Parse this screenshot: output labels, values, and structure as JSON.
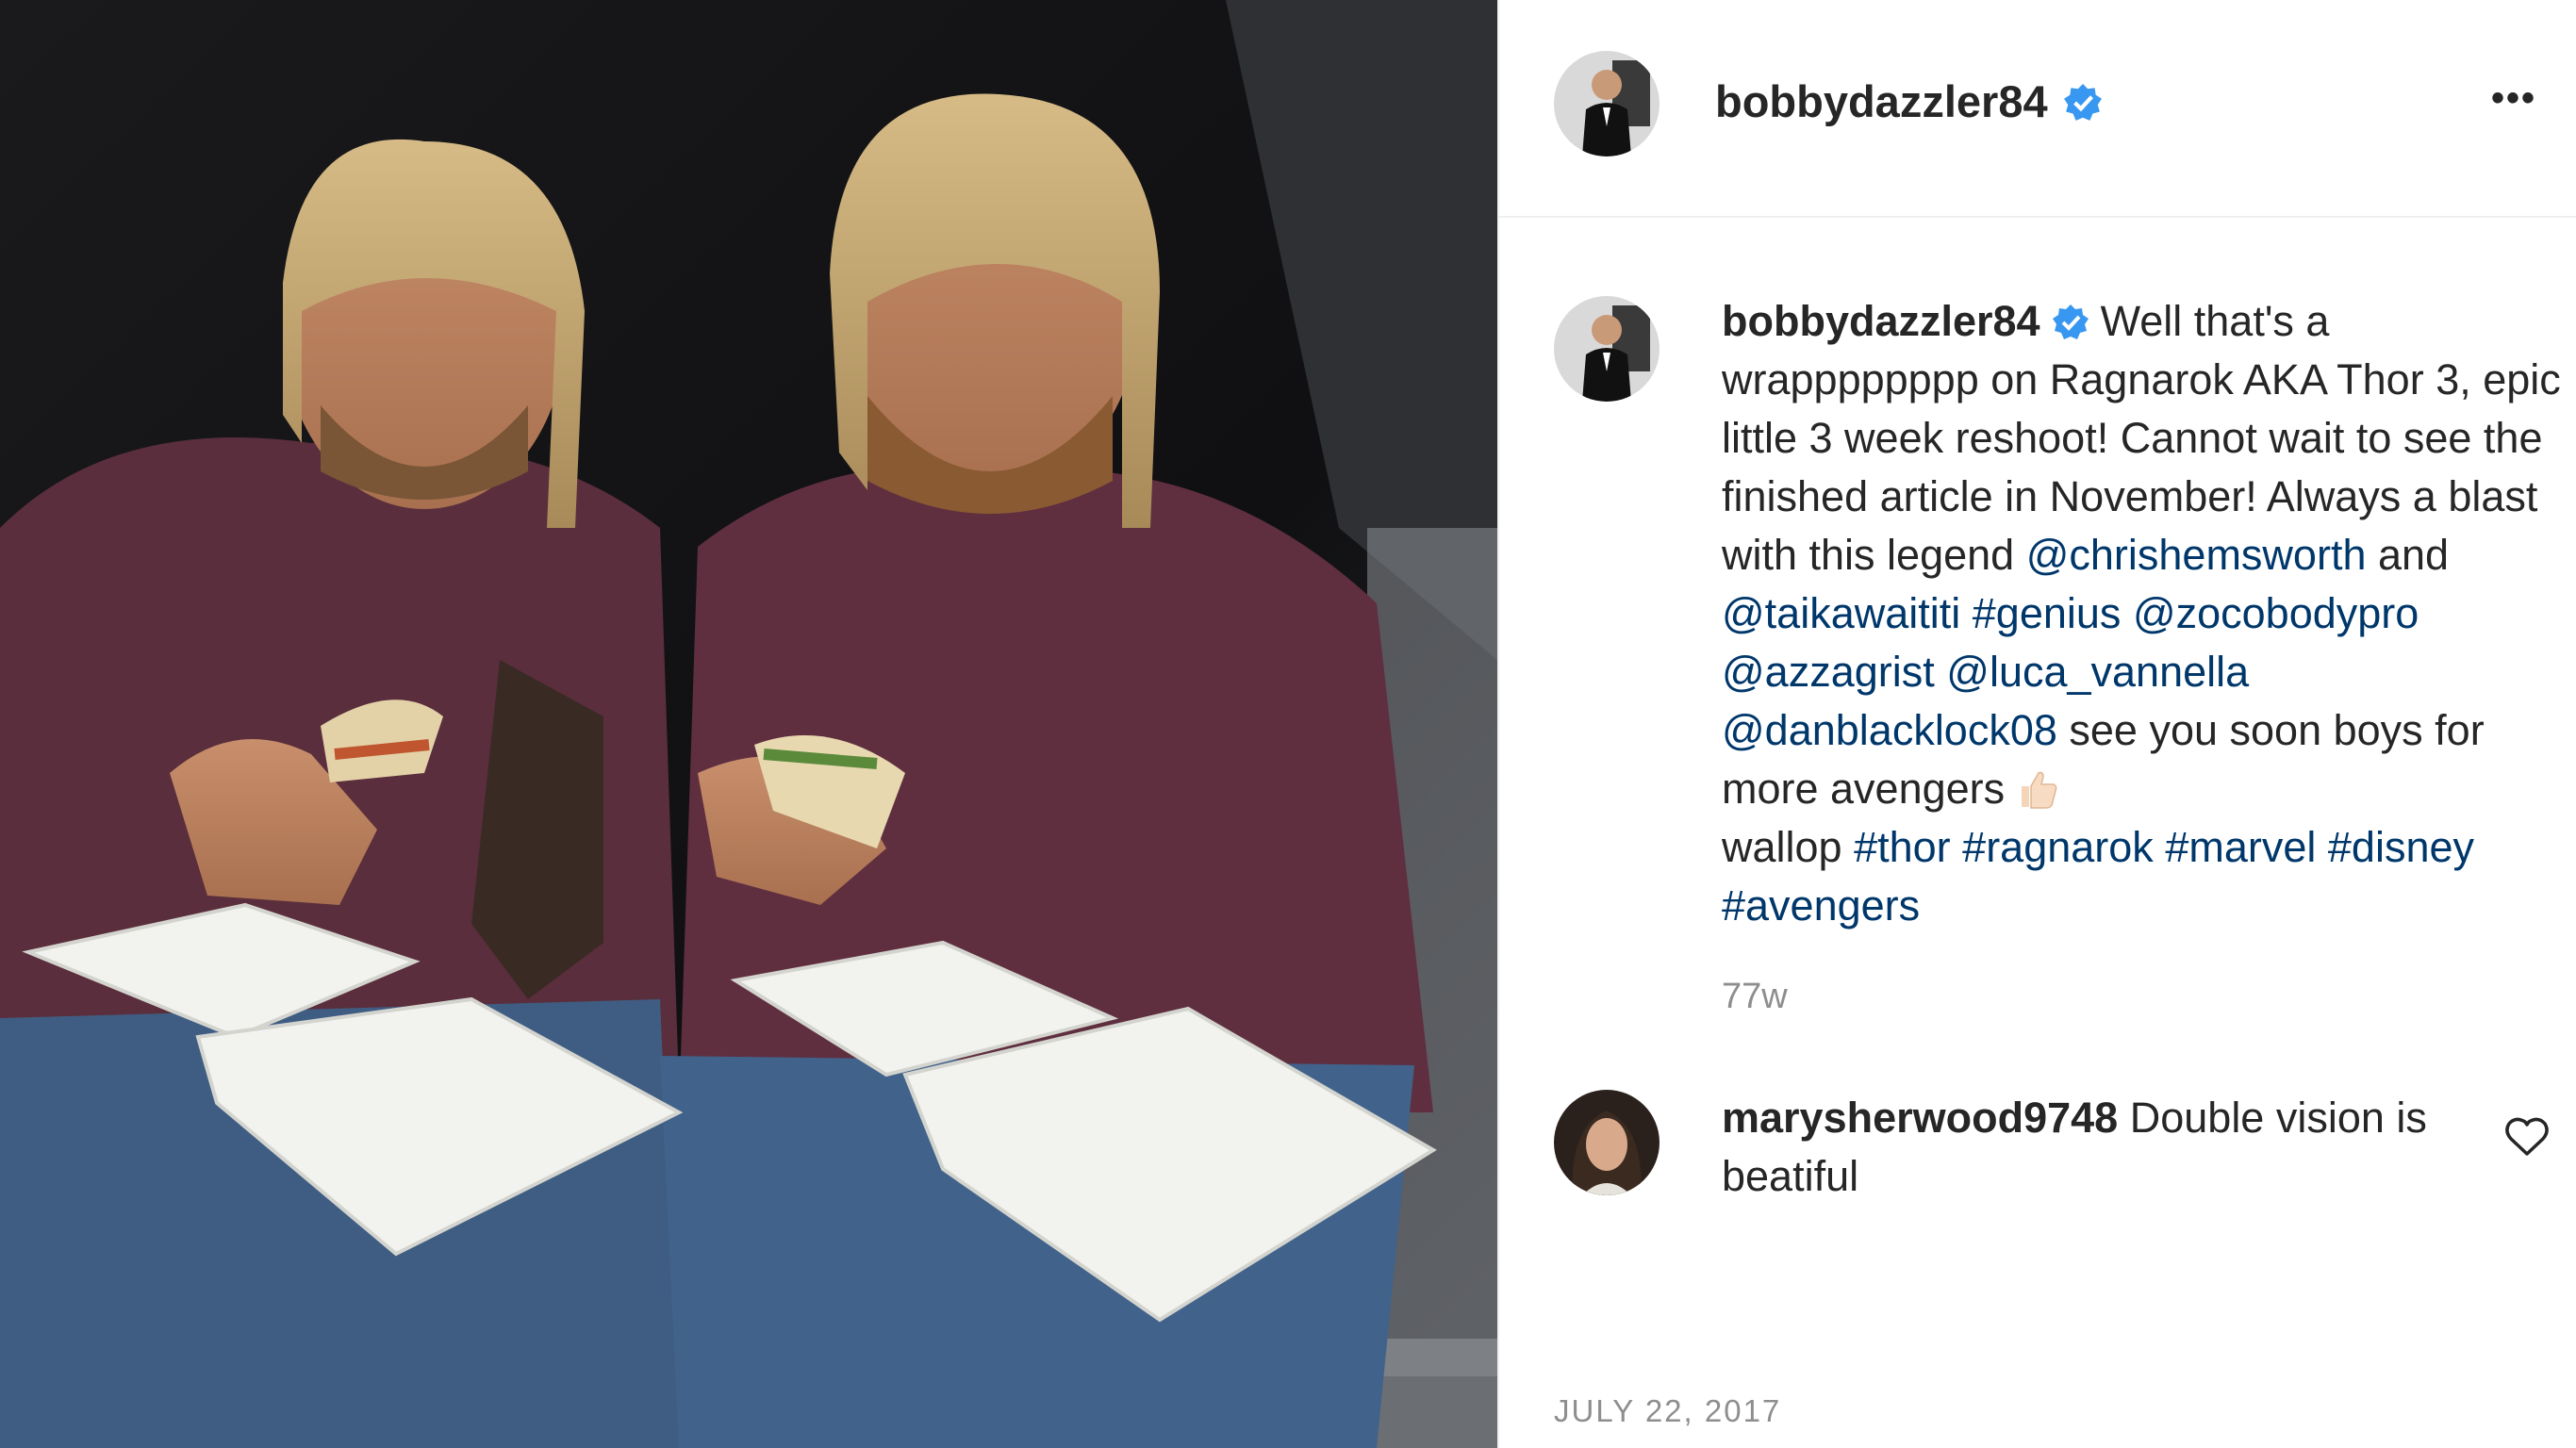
{
  "post": {
    "username": "bobbydazzler84",
    "more_label": "•••",
    "photo_alt": "Two men in maroon t-shirts eating sandwiches from takeout boxes"
  },
  "caption": {
    "username": "bobbydazzler84",
    "text_1": "Well that's a wrapppppppp on Ragnarok AKA Thor 3, epic little 3 week reshoot! Cannot wait to see the finished article in November! Always a blast with this legend ",
    "mention_1": "@chrishemsworth",
    "text_2": " and ",
    "mention_2": "@taikawaititi",
    "hashtag_1": "#genius",
    "mention_3": "@zocobodypro",
    "mention_4": "@azzagrist",
    "mention_5": "@luca_vannella",
    "mention_6": "@danblacklock08",
    "text_3": " see you soon boys for more avengers",
    "text_4": "wallop ",
    "hashtag_2": "#thor",
    "hashtag_3": "#ragnarok",
    "hashtag_4": "#marvel",
    "hashtag_5": "#disney",
    "hashtag_6": "#avengers",
    "time_ago": "77w"
  },
  "comment": {
    "username": "marysherwood9748",
    "text": "Double vision is beatiful"
  },
  "footer": {
    "date": "JULY 22, 2017"
  },
  "colors": {
    "verified": "#3897f0",
    "link": "#00376b",
    "muted": "#8e8e8e"
  }
}
